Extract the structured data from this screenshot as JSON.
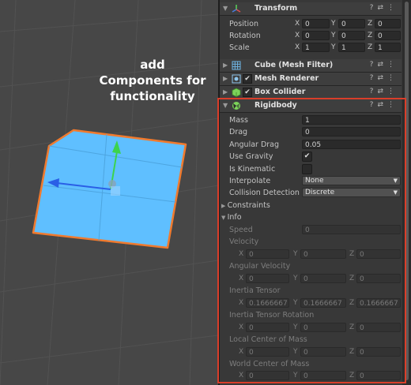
{
  "caption": {
    "line1": "add",
    "line2": "Components for",
    "line3": "functionality"
  },
  "icons": {
    "transform": "transform-axes-icon",
    "mesh_filter": "grid-mesh-icon",
    "mesh_renderer": "mesh-renderer-icon",
    "box_collider": "green-cube-icon",
    "rigidbody": "rigidbody-ball-icon"
  },
  "colors": {
    "highlight": "#d93e2a",
    "cube_fill": "#5fbfff",
    "cube_outline": "#f07a2e",
    "gizmo_y": "#3cd34c",
    "gizmo_x": "#2a5fe6"
  },
  "tool_glyphs": {
    "help": "?",
    "preset": "⇄",
    "menu": "⋮"
  },
  "transform": {
    "title": "Transform",
    "rows": [
      {
        "label": "Position",
        "x": "0",
        "y": "0",
        "z": "0"
      },
      {
        "label": "Rotation",
        "x": "0",
        "y": "0",
        "z": "0"
      },
      {
        "label": "Scale",
        "x": "1",
        "y": "1",
        "z": "1"
      }
    ]
  },
  "axes": {
    "x": "X",
    "y": "Y",
    "z": "Z"
  },
  "components": {
    "mesh_filter": "Cube (Mesh Filter)",
    "mesh_renderer": "Mesh Renderer",
    "box_collider": "Box Collider"
  },
  "rigidbody": {
    "title": "Rigidbody",
    "mass_label": "Mass",
    "mass": "1",
    "drag_label": "Drag",
    "drag": "0",
    "angular_drag_label": "Angular Drag",
    "angular_drag": "0.05",
    "use_gravity_label": "Use Gravity",
    "use_gravity": "✔",
    "is_kinematic_label": "Is Kinematic",
    "interpolate_label": "Interpolate",
    "interpolate": "None",
    "collision_label": "Collision Detection",
    "collision": "Discrete",
    "constraints_label": "Constraints",
    "info_label": "Info",
    "speed_label": "Speed",
    "speed": "0",
    "velocity_label": "Velocity",
    "velocity": {
      "x": "0",
      "y": "0",
      "z": "0"
    },
    "angular_velocity_label": "Angular Velocity",
    "angular_velocity": {
      "x": "0",
      "y": "0",
      "z": "0"
    },
    "inertia_tensor_label": "Inertia Tensor",
    "inertia_tensor": {
      "x": "0.1666667",
      "y": "0.1666667",
      "z": "0.1666667"
    },
    "inertia_rotation_label": "Inertia Tensor Rotation",
    "inertia_rotation": {
      "x": "0",
      "y": "0",
      "z": "0"
    },
    "local_com_label": "Local Center of Mass",
    "local_com": {
      "x": "0",
      "y": "0",
      "z": "0"
    },
    "world_com_label": "World Center of Mass",
    "world_com": {
      "x": "0",
      "y": "0",
      "z": "0"
    }
  }
}
